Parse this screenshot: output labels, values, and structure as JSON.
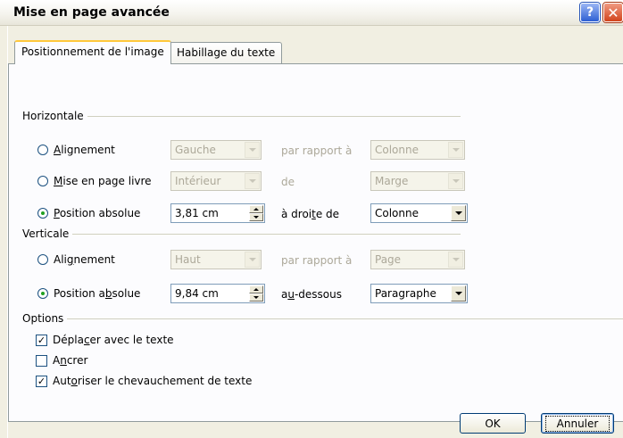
{
  "window": {
    "title": "Mise en page avancée",
    "help_glyph": "?",
    "close_glyph": "✕"
  },
  "tabs": [
    {
      "label": "Positionnement de l'image",
      "active": true
    },
    {
      "label": "Habillage du texte",
      "active": false
    }
  ],
  "horizontal": {
    "heading": "Horizontale",
    "rows": [
      {
        "radio_label_pre": "",
        "radio_label_u": "A",
        "radio_label_post": "lignement",
        "selected": false,
        "value": "Gauche",
        "relation": "par rapport à",
        "target": "Colonne",
        "enabled": false
      },
      {
        "radio_label_pre": "",
        "radio_label_u": "M",
        "radio_label_post": "ise en page livre",
        "selected": false,
        "value": "Intérieur",
        "relation": "de",
        "target": "Marge",
        "enabled": false
      },
      {
        "radio_label_pre": "",
        "radio_label_u": "P",
        "radio_label_post": "osition absolue",
        "selected": true,
        "value": "3,81 cm",
        "relation_pre": "à droi",
        "relation_u": "t",
        "relation_post": "e de",
        "target": "Colonne",
        "enabled": true
      }
    ]
  },
  "vertical": {
    "heading": "Verticale",
    "rows": [
      {
        "radio_label_pre": "Ali",
        "radio_label_u": "g",
        "radio_label_post": "nement",
        "selected": false,
        "value": "Haut",
        "relation": "par rapport à",
        "target": "Page",
        "enabled": false
      },
      {
        "radio_label_pre": "Position a",
        "radio_label_u": "b",
        "radio_label_post": "solue",
        "selected": true,
        "value": "9,84 cm",
        "relation_pre": "a",
        "relation_u": "u",
        "relation_post": "-dessous",
        "target": "Paragraphe",
        "enabled": true
      }
    ]
  },
  "options": {
    "heading": "Options",
    "items": [
      {
        "label_pre": "Dépla",
        "label_u": "c",
        "label_post": "er avec le texte",
        "checked": true
      },
      {
        "label_pre": "A",
        "label_u": "n",
        "label_post": "crer",
        "checked": false
      },
      {
        "label_pre": "Aut",
        "label_u": "o",
        "label_post": "riser le chevauchement de texte",
        "checked": true
      }
    ]
  },
  "buttons": {
    "ok": "OK",
    "cancel": "Annuler"
  }
}
